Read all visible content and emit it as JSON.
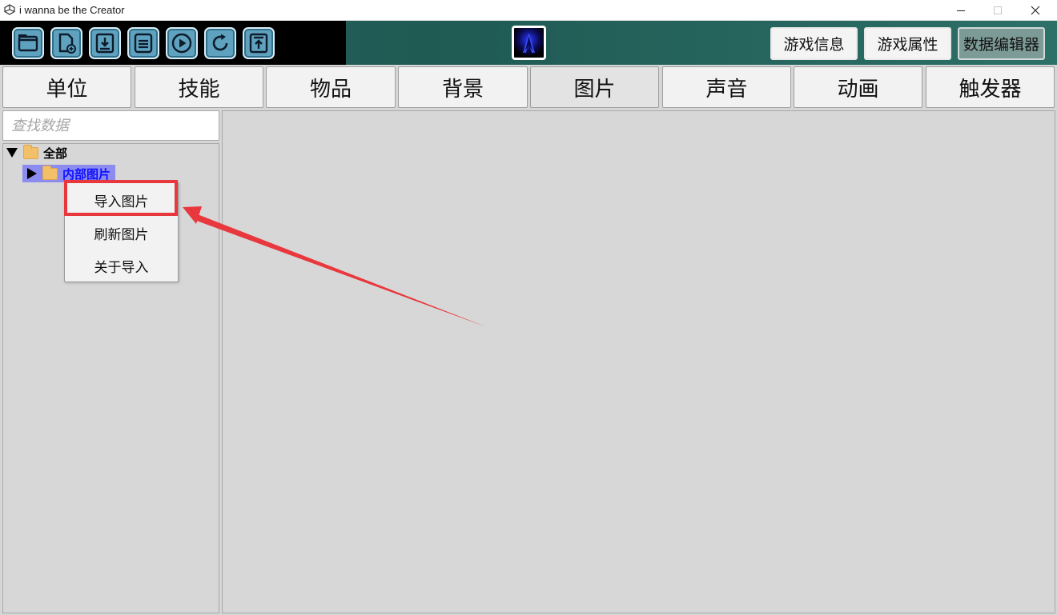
{
  "window": {
    "title": "i wanna be the Creator",
    "controls": [
      "minimize",
      "maximize",
      "close"
    ]
  },
  "toolbar": {
    "icons": [
      "open-folder-icon",
      "new-file-icon",
      "download-icon",
      "save-icon",
      "play-icon",
      "refresh-icon",
      "upload-icon"
    ],
    "buttons": [
      {
        "label": "游戏信息",
        "active": false
      },
      {
        "label": "游戏属性",
        "active": false
      },
      {
        "label": "数据编辑器",
        "active": true
      }
    ]
  },
  "tabs": [
    {
      "label": "单位",
      "selected": false
    },
    {
      "label": "技能",
      "selected": false
    },
    {
      "label": "物品",
      "selected": false
    },
    {
      "label": "背景",
      "selected": false
    },
    {
      "label": "图片",
      "selected": true
    },
    {
      "label": "声音",
      "selected": false
    },
    {
      "label": "动画",
      "selected": false
    },
    {
      "label": "触发器",
      "selected": false
    }
  ],
  "search": {
    "placeholder": "查找数据",
    "value": ""
  },
  "tree": {
    "root": {
      "label": "全部",
      "expanded": true
    },
    "child": {
      "label": "内部图片",
      "expanded": false,
      "selected": true
    }
  },
  "context_menu": {
    "items": [
      "导入图片",
      "刷新图片",
      "关于导入"
    ],
    "highlighted_item": "导入图片"
  },
  "colors": {
    "annotation_red": "#e8383d",
    "tree_selection": "#8c8cf0",
    "toolbar_teal": "#2a6b64"
  }
}
